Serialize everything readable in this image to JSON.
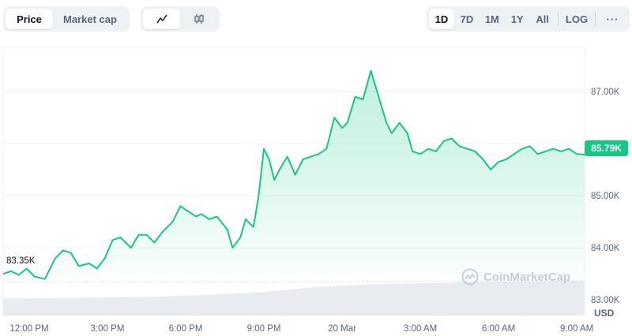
{
  "tabs": {
    "type": [
      {
        "label": "Price",
        "active": true
      },
      {
        "label": "Market cap",
        "active": false
      }
    ],
    "view": [
      {
        "icon": "line-chart-icon",
        "active": true
      },
      {
        "icon": "candlestick-icon",
        "active": false
      }
    ],
    "range": [
      {
        "label": "1D",
        "active": true
      },
      {
        "label": "7D",
        "active": false
      },
      {
        "label": "1M",
        "active": false
      },
      {
        "label": "1Y",
        "active": false
      },
      {
        "label": "All",
        "active": false
      }
    ],
    "log_label": "LOG",
    "more_label": "···"
  },
  "chart_data": {
    "type": "area",
    "currency_label": "USD",
    "current_price_label": "85.79K",
    "reference_label": "83.35K",
    "reference_value": 83350,
    "y_ticks": [
      "83.00K",
      "84.00K",
      "85.00K",
      "86.00K",
      "87.00K"
    ],
    "y_tick_values": [
      83000,
      84000,
      85000,
      86000,
      87000
    ],
    "ylim": [
      82700,
      87850
    ],
    "x_ticks": [
      "12:00 PM",
      "3:00 PM",
      "6:00 PM",
      "9:00 PM",
      "20 Mar",
      "3:00 AM",
      "6:00 AM",
      "9:00 AM"
    ],
    "x_tick_hours": [
      12,
      15,
      18,
      21,
      24,
      27,
      30,
      33
    ],
    "xlim": [
      11.0,
      33.3
    ],
    "grid": true,
    "colors": {
      "line": "#16c784",
      "volume": "#e8ecf1",
      "reference": "#cfd6e4"
    },
    "watermark": "CoinMarketCap",
    "series": [
      {
        "hours": [
          11.0,
          11.3,
          11.6,
          11.9,
          12.2,
          12.6,
          13.0,
          13.3,
          13.6,
          13.9,
          14.3,
          14.6,
          14.9,
          15.2,
          15.5,
          15.9,
          16.2,
          16.5,
          16.8,
          17.1,
          17.5,
          17.8,
          18.1,
          18.4,
          18.6,
          18.9,
          19.2,
          19.6,
          19.8,
          20.1,
          20.3,
          20.6,
          20.8,
          21.0,
          21.2,
          21.4,
          21.6,
          21.9,
          22.2,
          22.5,
          22.8,
          23.1,
          23.4,
          23.7,
          24.0,
          24.2,
          24.5,
          24.8,
          25.1,
          25.4,
          25.7,
          25.9,
          26.2,
          26.5,
          26.7,
          27.0,
          27.3,
          27.6,
          27.9,
          28.2,
          28.5,
          28.8,
          29.1,
          29.4,
          29.7,
          30.0,
          30.3,
          30.6,
          30.9,
          31.2,
          31.5,
          31.8,
          32.1,
          32.4,
          32.7,
          33.0,
          33.3
        ],
        "values": [
          83500,
          83550,
          83480,
          83600,
          83450,
          83400,
          83800,
          83950,
          83900,
          83650,
          83700,
          83600,
          83800,
          84150,
          84200,
          84000,
          84250,
          84250,
          84100,
          84300,
          84500,
          84800,
          84700,
          84600,
          84650,
          84550,
          84600,
          84350,
          84000,
          84200,
          84550,
          84400,
          85000,
          85900,
          85700,
          85300,
          85500,
          85750,
          85400,
          85700,
          85750,
          85800,
          85900,
          86500,
          86300,
          86400,
          86900,
          86850,
          87400,
          86900,
          86400,
          86200,
          86400,
          86200,
          85850,
          85800,
          85900,
          85850,
          86050,
          86100,
          85950,
          85900,
          85850,
          85700,
          85500,
          85650,
          85700,
          85800,
          85900,
          85950,
          85800,
          85850,
          85900,
          85850,
          85900,
          85800,
          85790
        ]
      }
    ],
    "volume": {
      "hours": [
        11.0,
        13.0,
        15.0,
        17.0,
        19.0,
        21.0,
        23.0,
        25.0,
        27.0,
        29.0,
        31.0,
        33.3
      ],
      "values": [
        0.45,
        0.46,
        0.48,
        0.5,
        0.55,
        0.62,
        0.75,
        0.82,
        0.85,
        0.88,
        0.9,
        0.92
      ]
    }
  }
}
